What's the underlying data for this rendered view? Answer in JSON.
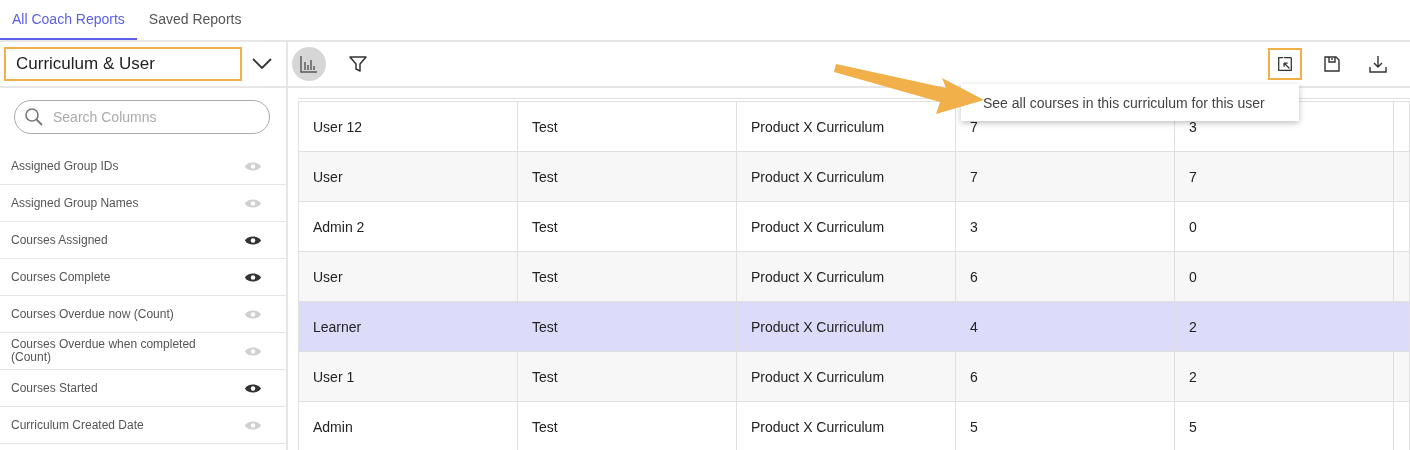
{
  "tabs": [
    {
      "label": "All Coach Reports",
      "selected": true
    },
    {
      "label": "Saved Reports",
      "selected": false
    }
  ],
  "report_select": {
    "value": "Curriculum & User",
    "highlighted": true
  },
  "toolbar": {
    "chart_toggle_on": true,
    "drilldown_highlighted": true
  },
  "tooltip": {
    "text": "See all courses in this curriculum for this user"
  },
  "sidebar": {
    "search": {
      "placeholder": "Search Columns"
    },
    "columns": [
      {
        "label": "Assigned Group IDs",
        "visible": false
      },
      {
        "label": "Assigned Group Names",
        "visible": false
      },
      {
        "label": "Courses Assigned",
        "visible": true
      },
      {
        "label": "Courses Complete",
        "visible": true
      },
      {
        "label": "Courses Overdue now (Count)",
        "visible": false
      },
      {
        "label": "Courses Overdue when completed (Count)",
        "visible": false
      },
      {
        "label": "Courses Started",
        "visible": true
      },
      {
        "label": "Curriculum Created Date",
        "visible": false
      }
    ]
  },
  "table": {
    "rows": [
      {
        "cells": [
          "User 12",
          "Test",
          "Product X Curriculum",
          "7",
          "3"
        ],
        "selected": false
      },
      {
        "cells": [
          "User",
          "Test",
          "Product X Curriculum",
          "7",
          "7"
        ],
        "selected": false
      },
      {
        "cells": [
          "Admin 2",
          "Test",
          "Product X Curriculum",
          "3",
          "0"
        ],
        "selected": false
      },
      {
        "cells": [
          "User",
          "Test",
          "Product X Curriculum",
          "6",
          "0"
        ],
        "selected": false
      },
      {
        "cells": [
          "Learner",
          "Test",
          "Product X Curriculum",
          "4",
          "2"
        ],
        "selected": true
      },
      {
        "cells": [
          "User 1",
          "Test",
          "Product X Curriculum",
          "6",
          "2"
        ],
        "selected": false
      },
      {
        "cells": [
          "Admin",
          "Test",
          "Product X Curriculum",
          "5",
          "5"
        ],
        "selected": false
      }
    ]
  }
}
